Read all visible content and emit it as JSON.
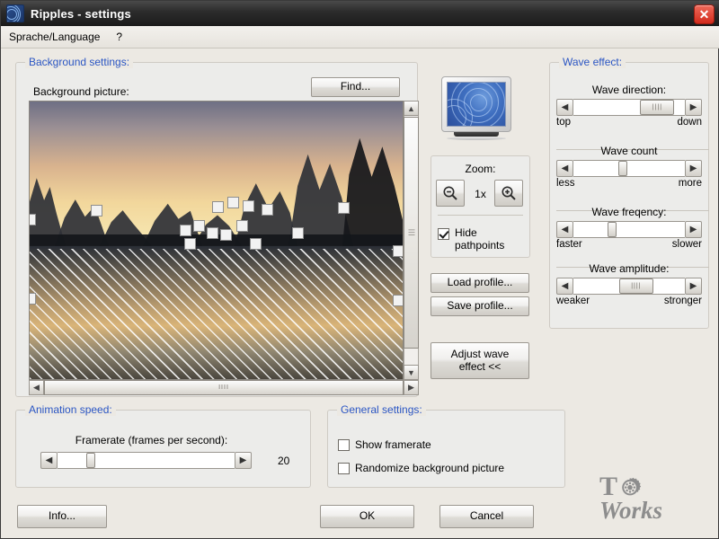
{
  "window": {
    "title": "Ripples - settings",
    "app_icon": "ripple-icon",
    "close_label": "✕"
  },
  "menu": {
    "items": [
      {
        "label": "Sprache/Language"
      },
      {
        "label": "?"
      }
    ]
  },
  "background_settings": {
    "title": "Background settings:",
    "picture_label": "Background picture:",
    "find_button": "Find...",
    "scroll": {
      "up_arrow": "▲",
      "down_arrow": "▼",
      "left_arrow": "◀",
      "right_arrow": "▶",
      "grip": "IIII"
    }
  },
  "preview": {
    "monitor_alt": "monitor-preview"
  },
  "zoom": {
    "title": "Zoom:",
    "zoom_out": "zoom-out",
    "zoom_in": "zoom-in",
    "level": "1x"
  },
  "hide_pathpoints": {
    "label": "Hide\npathpoints",
    "label_line1": "Hide",
    "label_line2": "pathpoints",
    "checked": true
  },
  "profile": {
    "load_button": "Load profile...",
    "save_button": "Save profile..."
  },
  "adjust": {
    "button_line1": "Adjust wave",
    "button_line2": "effect <<"
  },
  "wave_effect": {
    "title": "Wave effect:",
    "sliders": [
      {
        "label": "Wave direction:",
        "min_label": "top",
        "max_label": "down",
        "value_pct": 62,
        "thumb_wide": true
      },
      {
        "label": "Wave count",
        "min_label": "less",
        "max_label": "more",
        "value_pct": 40,
        "thumb_wide": false
      },
      {
        "label": "Wave freqency:",
        "min_label": "faster",
        "max_label": "slower",
        "value_pct": 33,
        "thumb_wide": false
      },
      {
        "label": "Wave amplitude:",
        "min_label": "weaker",
        "max_label": "stronger",
        "value_pct": 44,
        "thumb_wide": true
      }
    ]
  },
  "animation_speed": {
    "title": "Animation speed:",
    "framerate_label": "Framerate (frames per second):",
    "left_arrow": "◀",
    "right_arrow": "▶",
    "value": "20",
    "value_pct": 18
  },
  "general_settings": {
    "title": "General settings:",
    "checkboxes": [
      {
        "label": "Show framerate",
        "checked": false
      },
      {
        "label": "Randomize background picture",
        "checked": false
      }
    ]
  },
  "footer": {
    "info_button": "Info...",
    "ok_button": "OK",
    "cancel_button": "Cancel"
  },
  "logo": {
    "t": "T",
    "o": "gear-icon",
    "works": "Works"
  }
}
